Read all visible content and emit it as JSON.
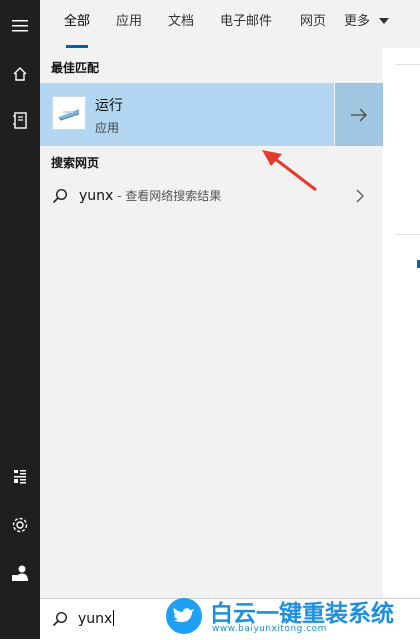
{
  "tabs": [
    {
      "label": "全部",
      "active": true
    },
    {
      "label": "应用",
      "active": false
    },
    {
      "label": "文档",
      "active": false
    },
    {
      "label": "电子邮件",
      "active": false
    },
    {
      "label": "网页",
      "active": false
    },
    {
      "label": "更多",
      "active": false
    }
  ],
  "sections": {
    "best_match": "最佳匹配",
    "search_web": "搜索网页"
  },
  "best_match": {
    "title": "运行",
    "subtitle": "应用"
  },
  "web_result": {
    "query": "yunx",
    "description": " - 查看网络搜索结果"
  },
  "search": {
    "value": "yunx"
  },
  "watermark": {
    "text": "白云一键重装系统",
    "url": "www.baiyunxitong.com"
  },
  "rail_icons": [
    "hamburger-icon",
    "home-icon",
    "documents-icon",
    "gear-icon",
    "user-icon"
  ],
  "colors": {
    "accent": "#0063b1",
    "selection": "#b3d7f2",
    "rail": "#1f1f1f",
    "annotation_arrow": "#e8392b"
  }
}
